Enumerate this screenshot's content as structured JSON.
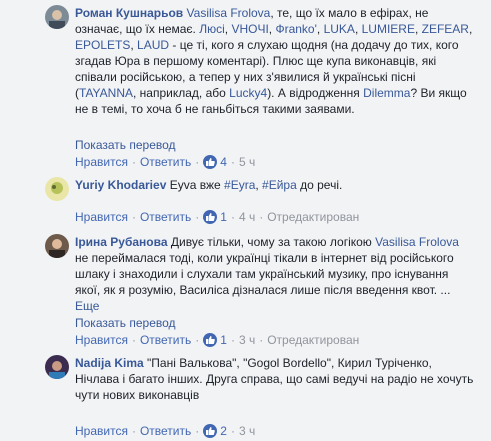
{
  "comments": [
    {
      "author": "Роман Кушнарьов",
      "segments": [
        {
          "t": "Vasilisa Frolova",
          "k": "mention"
        },
        {
          "t": ", те, що їх мало в ефірах, не означає, що їх немає. ",
          "k": "text"
        },
        {
          "t": "Люсі",
          "k": "link"
        },
        {
          "t": ", ",
          "k": "text"
        },
        {
          "t": "VHOЧІ",
          "k": "link"
        },
        {
          "t": ", ",
          "k": "text"
        },
        {
          "t": "Фranko'",
          "k": "link"
        },
        {
          "t": ", ",
          "k": "text"
        },
        {
          "t": "LUKA",
          "k": "link"
        },
        {
          "t": ", ",
          "k": "text"
        },
        {
          "t": "LUMIERE",
          "k": "link"
        },
        {
          "t": ", ",
          "k": "text"
        },
        {
          "t": "ZEFEAR",
          "k": "link"
        },
        {
          "t": ", ",
          "k": "text"
        },
        {
          "t": "EPOLETS",
          "k": "link"
        },
        {
          "t": ", ",
          "k": "text"
        },
        {
          "t": "LAUD",
          "k": "link"
        },
        {
          "t": " - це ті, кого я слухаю щодня (на додачу до тих, кого згадав Юра в першому коментарі). Плюс ще купа виконавців, які співали російською, а тепер у них з'явилися й українські пісні (",
          "k": "text"
        },
        {
          "t": "TAYANNA",
          "k": "link"
        },
        {
          "t": ", наприклад, або ",
          "k": "text"
        },
        {
          "t": "Lucky4",
          "k": "link"
        },
        {
          "t": "). А відродження ",
          "k": "text"
        },
        {
          "t": "Dilemma",
          "k": "link"
        },
        {
          "t": "? Ви якщо не в темі, то хоча б не ганьбіться такими заявами.",
          "k": "text"
        }
      ],
      "translate": "Показать перевод",
      "like": "Нравится",
      "reply": "Ответить",
      "likes": "4",
      "time": "5 ч",
      "edited": ""
    },
    {
      "author": "Yuriy Khodariev",
      "segments": [
        {
          "t": "Eyva вже ",
          "k": "text"
        },
        {
          "t": "#Eyra",
          "k": "link"
        },
        {
          "t": ", ",
          "k": "text"
        },
        {
          "t": "#Ейра",
          "k": "link"
        },
        {
          "t": " до речі.",
          "k": "text"
        }
      ],
      "translate": "",
      "like": "Нравится",
      "reply": "Ответить",
      "likes": "1",
      "time": "4 ч",
      "edited": "Отредактирован"
    },
    {
      "author": "Ірина Рубанова",
      "segments": [
        {
          "t": "Дивує тільки, чому за такою логікою ",
          "k": "text"
        },
        {
          "t": "Vasilisa Frolova",
          "k": "mention"
        },
        {
          "t": " не переймалася тоді, коли українці тікали в інтернет від російського шлаку і знаходили і слухали там український музику, про існування якої, як я розумію, Василіса дізналася лише після введення квот. ... ",
          "k": "text"
        },
        {
          "t": "Еще",
          "k": "link"
        }
      ],
      "translate": "Показать перевод",
      "like": "Нравится",
      "reply": "Ответить",
      "likes": "1",
      "time": "3 ч",
      "edited": "Отредактирован"
    },
    {
      "author": "Nadija Kima",
      "segments": [
        {
          "t": "\"Пані Валькова\", \"Gogol Bordello\", Кирил Турiченко, Нiчлава i багато iнших. Друга справа, що самi ведучi на радiо не хочуть чути нових виконавцiв",
          "k": "text"
        }
      ],
      "translate": "",
      "like": "Нравится",
      "reply": "Ответить",
      "likes": "2",
      "time": "3 ч",
      "edited": ""
    }
  ],
  "colors": {
    "link": "#385898",
    "muted": "#90949c",
    "background": "#f2f3f5"
  }
}
